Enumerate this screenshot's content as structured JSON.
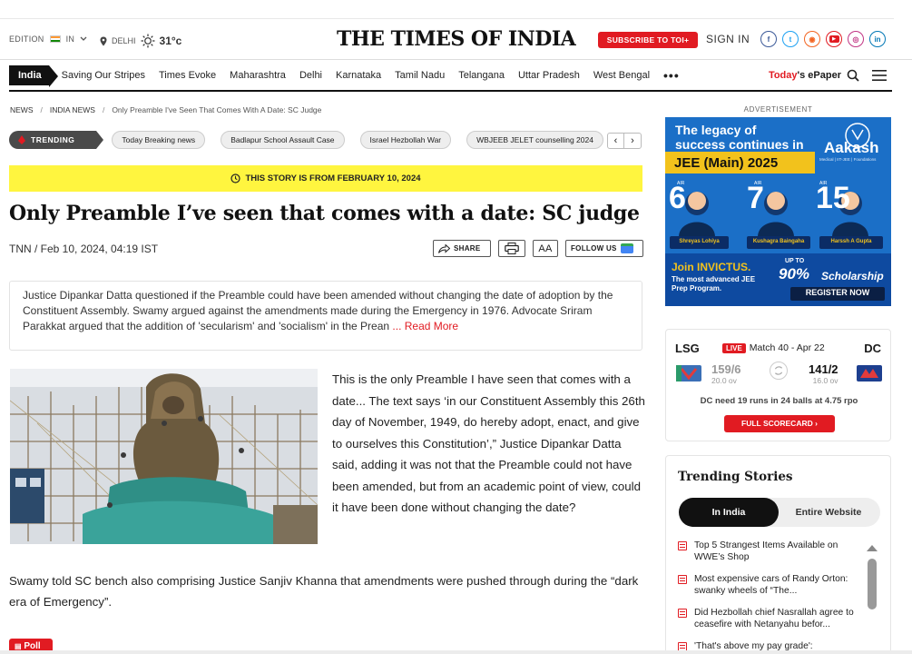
{
  "header": {
    "edition_label": "EDITION",
    "edition_value": "IN",
    "city": "DELHI",
    "temperature": "31°c",
    "logo": "THE TIMES OF INDIA",
    "subscribe_label": "SUBSCRIBE TO TOI+",
    "signin_label": "SIGN IN",
    "social_icons": [
      "facebook-icon",
      "twitter-icon",
      "rss-icon",
      "youtube-icon",
      "instagram-icon",
      "linkedin-icon"
    ]
  },
  "nav": {
    "home": "India",
    "items": [
      "Saving Our Stripes",
      "Times Evoke",
      "Maharashtra",
      "Delhi",
      "Karnataka",
      "Tamil Nadu",
      "Telangana",
      "Uttar Pradesh",
      "West Bengal"
    ],
    "more": "•••",
    "epaper_today": "Today",
    "epaper_rest": "'s ePaper"
  },
  "breadcrumb": {
    "items": [
      "NEWS",
      "INDIA NEWS",
      "Only Preamble I've Seen That Comes With A Date: SC Judge"
    ]
  },
  "trending": {
    "label": "TRENDING",
    "pills": [
      "Today Breaking news",
      "Badlapur School Assault Case",
      "Israel Hezbollah War",
      "WBJEEB JELET counselling 2024"
    ],
    "prev": "‹",
    "next": "›"
  },
  "article": {
    "date_banner": "THIS STORY IS FROM FEBRUARY 10, 2024",
    "headline": "Only Preamble I’ve seen that comes with a date: SC judge",
    "byline": "TNN / Feb 10, 2024, 04:19 IST",
    "share_label": "SHARE",
    "font_label": "AA",
    "follow_label": "FOLLOW US",
    "summary": "Justice Dipankar Datta questioned if the Preamble could have been amended without changing the date of adoption by the Constituent Assembly. Swamy argued against the amendments made during the Emergency in 1976. Advocate Sriram Parakkat argued that the addition of 'secularism' and 'socialism' in the Prean",
    "read_more": "... Read More",
    "para1": "This is the only Preamble I have seen that comes with a date... The text says ‘in our Constituent Assembly this 26th day of November, 1949, do hereby adopt, enact, and give to ourselves this Constitution’,” Justice Dipankar Datta said, adding it was not that the Preamble could not have been amended, but from an academic point of view, could it have been done without changing the date?",
    "para2": "Swamy told SC bench also comprising Justice Sanjiv Khanna that amendments were pushed through during the “dark era of Emergency”.",
    "poll_label": "Poll"
  },
  "sidebar": {
    "ad_label": "ADVERTISEMENT",
    "ad": {
      "headline1": "The legacy of",
      "headline2": "success continues in",
      "brand": "Aakash",
      "brand_sub": "Medical | IIT-JEE | Foundations",
      "exam": "JEE (Main) 2025",
      "ranks": [
        "6",
        "7",
        "15"
      ],
      "air": "AIR",
      "students": [
        "Shreyas Lohiya",
        "Kushagra Baingaha",
        "Harssh A Gupta"
      ],
      "join": "Join INVICTUS.",
      "join_sub": "The most advanced JEE Prep Program.",
      "upto": "UP TO",
      "scholarship_pct": "90%",
      "scholarship": "Scholarship",
      "register": "REGISTER NOW"
    },
    "score": {
      "team1": "LSG",
      "team2": "DC",
      "live": "LIVE",
      "match": "Match 40 - Apr 22",
      "score1": "159/6",
      "overs1": "20.0 ov",
      "score2": "141/2",
      "overs2": "16.0 ov",
      "need": "DC need 19 runs in 24 balls at 4.75 rpo",
      "full_scorecard": "FULL SCORECARD"
    },
    "trending_stories": {
      "title": "Trending Stories",
      "tabs": [
        "In India",
        "Entire Website"
      ],
      "items": [
        "Top 5 Strangest Items Available on WWE’s Shop",
        "Most expensive cars of Randy Orton: swanky wheels of “The...",
        "Did Hezbollah chief Nasrallah agree to ceasefire with Netanyahu befor...",
        "'That's above my pay grade':"
      ]
    }
  }
}
